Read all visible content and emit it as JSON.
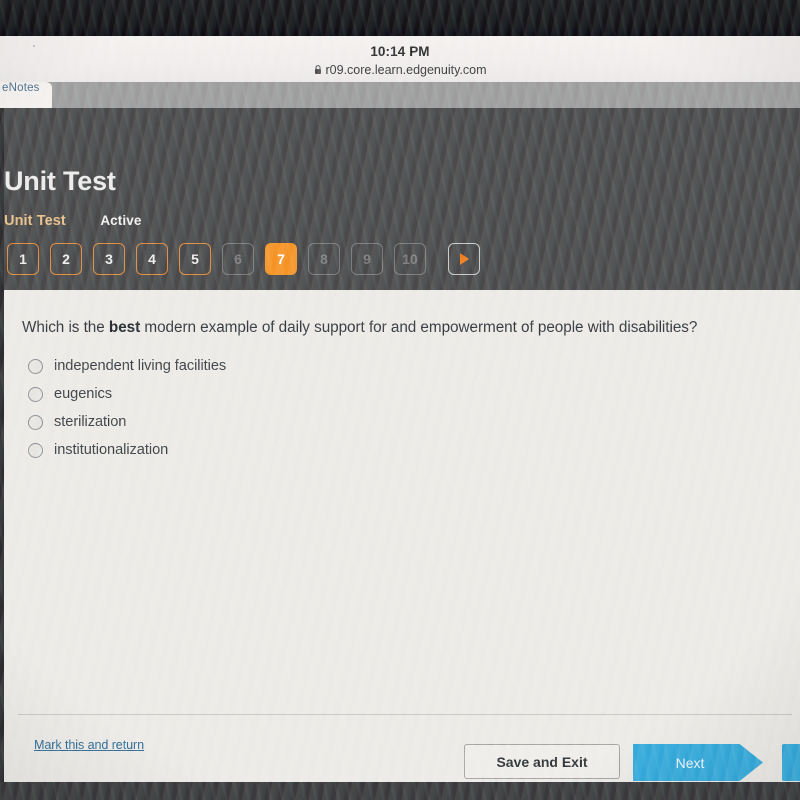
{
  "browser": {
    "status_time": "10:14 PM",
    "url": "r09.core.learn.edgenuity.com",
    "lock_icon": "lock-icon",
    "tab_label": "eNotes"
  },
  "header": {
    "page_title": "Unit Test",
    "subtab_label": "Unit Test",
    "status_label": "Active",
    "colors": {
      "background": "#4a4a4b",
      "accent_orange": "#f59324",
      "answered_border": "#e08a3c",
      "subtab_text": "#e8c089"
    }
  },
  "pager": {
    "items": [
      {
        "label": "1",
        "state": "answered"
      },
      {
        "label": "2",
        "state": "answered"
      },
      {
        "label": "3",
        "state": "answered"
      },
      {
        "label": "4",
        "state": "answered"
      },
      {
        "label": "5",
        "state": "answered"
      },
      {
        "label": "6",
        "state": "locked"
      },
      {
        "label": "7",
        "state": "current"
      },
      {
        "label": "8",
        "state": "locked"
      },
      {
        "label": "9",
        "state": "locked"
      },
      {
        "label": "10",
        "state": "locked"
      }
    ],
    "next_arrow_icon": "triangle-right-icon"
  },
  "question": {
    "prefix": "Which is the ",
    "emphasis": "best",
    "suffix": " modern example of daily support for and empowerment of people with disabilities?",
    "options": [
      {
        "label": "independent living facilities",
        "selected": false
      },
      {
        "label": "eugenics",
        "selected": false
      },
      {
        "label": "sterilization",
        "selected": false
      },
      {
        "label": "institutionalization",
        "selected": false
      }
    ]
  },
  "footer": {
    "mark_return_label": "Mark this and return",
    "save_exit_label": "Save and Exit",
    "next_label": "Next",
    "next_button_color": "#34aadc",
    "link_color": "#2e6b95"
  }
}
